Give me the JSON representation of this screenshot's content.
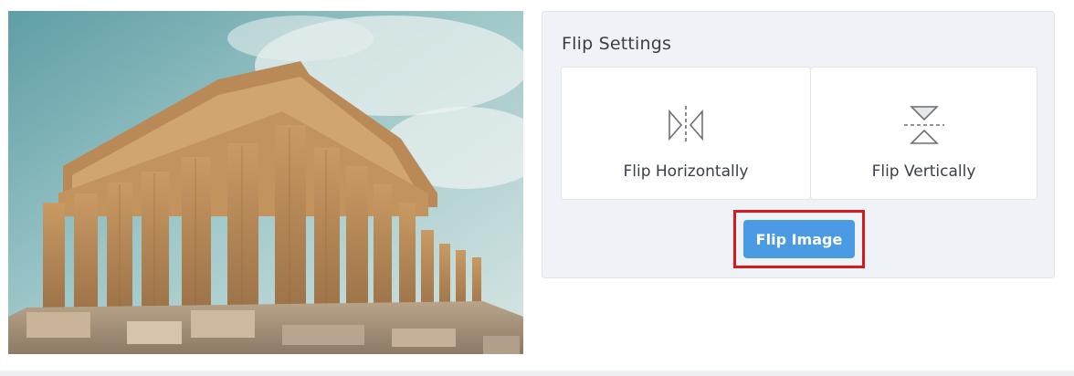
{
  "photo": {
    "alt": "Parthenon temple ruins under a blue sky"
  },
  "settings": {
    "title": "Flip Settings",
    "options": [
      {
        "label": "Flip Horizontally",
        "icon": "flip-horizontal-icon"
      },
      {
        "label": "Flip Vertically",
        "icon": "flip-vertical-icon"
      }
    ],
    "button_label": "Flip Image"
  },
  "colors": {
    "panel_bg": "#eff2f7",
    "button": "#4a9ae4",
    "highlight": "#d71920",
    "text": "#3a3f47"
  }
}
